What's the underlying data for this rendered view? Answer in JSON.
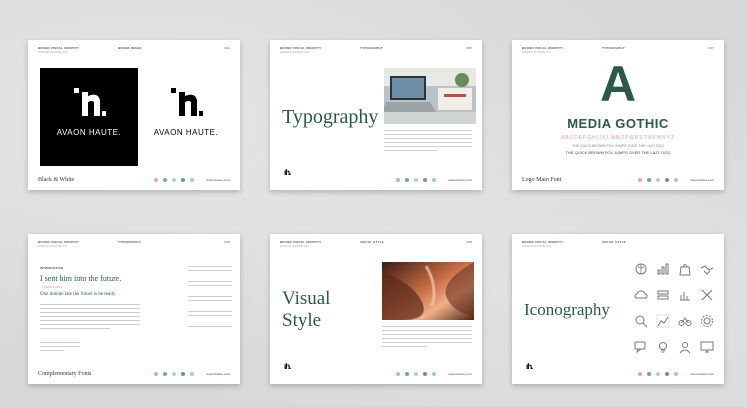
{
  "header": {
    "brand": "BRAND VISUAL IDENTITY",
    "sub": "AVAON HAUTE CO."
  },
  "website": "avaonhaute.com",
  "social_colors": [
    "#e3a6a6",
    "#6aa0d8",
    "#c8c8c8",
    "#6d8cc4",
    "#9ed0c8"
  ],
  "cards": {
    "c1": {
      "section": "BRAND IMAGE",
      "page": "004",
      "logo_mark": "ˑıh.",
      "logo_name": "AVAON HAUTE.",
      "footer_label": "Black & White"
    },
    "c2": {
      "section": "TYPOGRAPHY",
      "page": "005",
      "title": "Typography"
    },
    "c3": {
      "section": "TYPOGRAPHY",
      "page": "007",
      "glyph": "A",
      "font_name": "MEDIA GOTHIC",
      "alphabet": "ABCDEFGHIJKLMNOPQRSTUVWXYZ",
      "pangram1": "THE QUICK BROWN FOX JUMPS OVER THE LAZY DOG",
      "pangram2": "THE QUICK BROWN FOX JUMPS OVER THE LAZY DOG",
      "footer_label": "Logo Main Font"
    },
    "c4": {
      "section": "TYPOGRAPHY",
      "page": "008",
      "intro": "INTRODUCTION",
      "headline": "I sent him into the future.",
      "pink_line": "Quote Author",
      "subline": "One minute late the future is be ready.",
      "footer_label": "Complementary Fonts"
    },
    "c5": {
      "section": "VISUAL STYLE",
      "page": "008",
      "title_line1": "Visual",
      "title_line2": "Style"
    },
    "c6": {
      "section": "VISUAL STYLE",
      "page": "",
      "title": "Iconography"
    }
  },
  "icons": [
    "brain-icon",
    "chart-icon",
    "bag-icon",
    "handshake-icon",
    "cloud-icon",
    "stack-icon",
    "bar-chart-icon",
    "tools-icon",
    "search-icon",
    "analytics-icon",
    "bike-icon",
    "gear-icon",
    "chat-icon",
    "bulb-icon",
    "person-icon",
    "monitor-icon"
  ]
}
